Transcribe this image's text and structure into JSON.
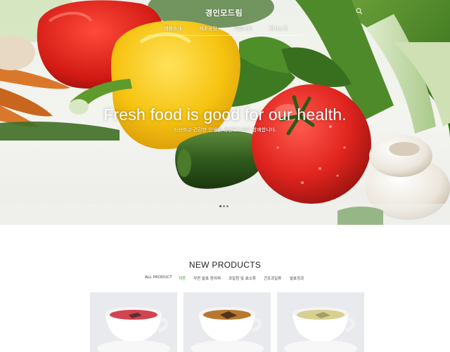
{
  "header": {
    "logo": "경인모드림",
    "nav": [
      "제품소개",
      "제조공정",
      "커뮤니티",
      "회사소개"
    ]
  },
  "hero": {
    "title": "Fresh food is good for our health.",
    "subtitle": "신선하고 건강한 인생을 경인모드림이 함께합니다.",
    "slides": 3,
    "active_slide": 1
  },
  "products": {
    "title": "NEW PRODUCTS",
    "tabs": [
      "ALL PRODUCT",
      "제품",
      "자연 발효 장아찌",
      "과일청 및 효소류",
      "건조과일류",
      "발효정과"
    ],
    "active_tab": "제품",
    "cards": [
      {
        "tea_color": "#d2444f"
      },
      {
        "tea_color": "#b9772e"
      },
      {
        "tea_color": "#d9cf8f"
      }
    ]
  },
  "colors": {
    "accent_green": "#6aa84f",
    "nav_text": "#ffffff"
  }
}
